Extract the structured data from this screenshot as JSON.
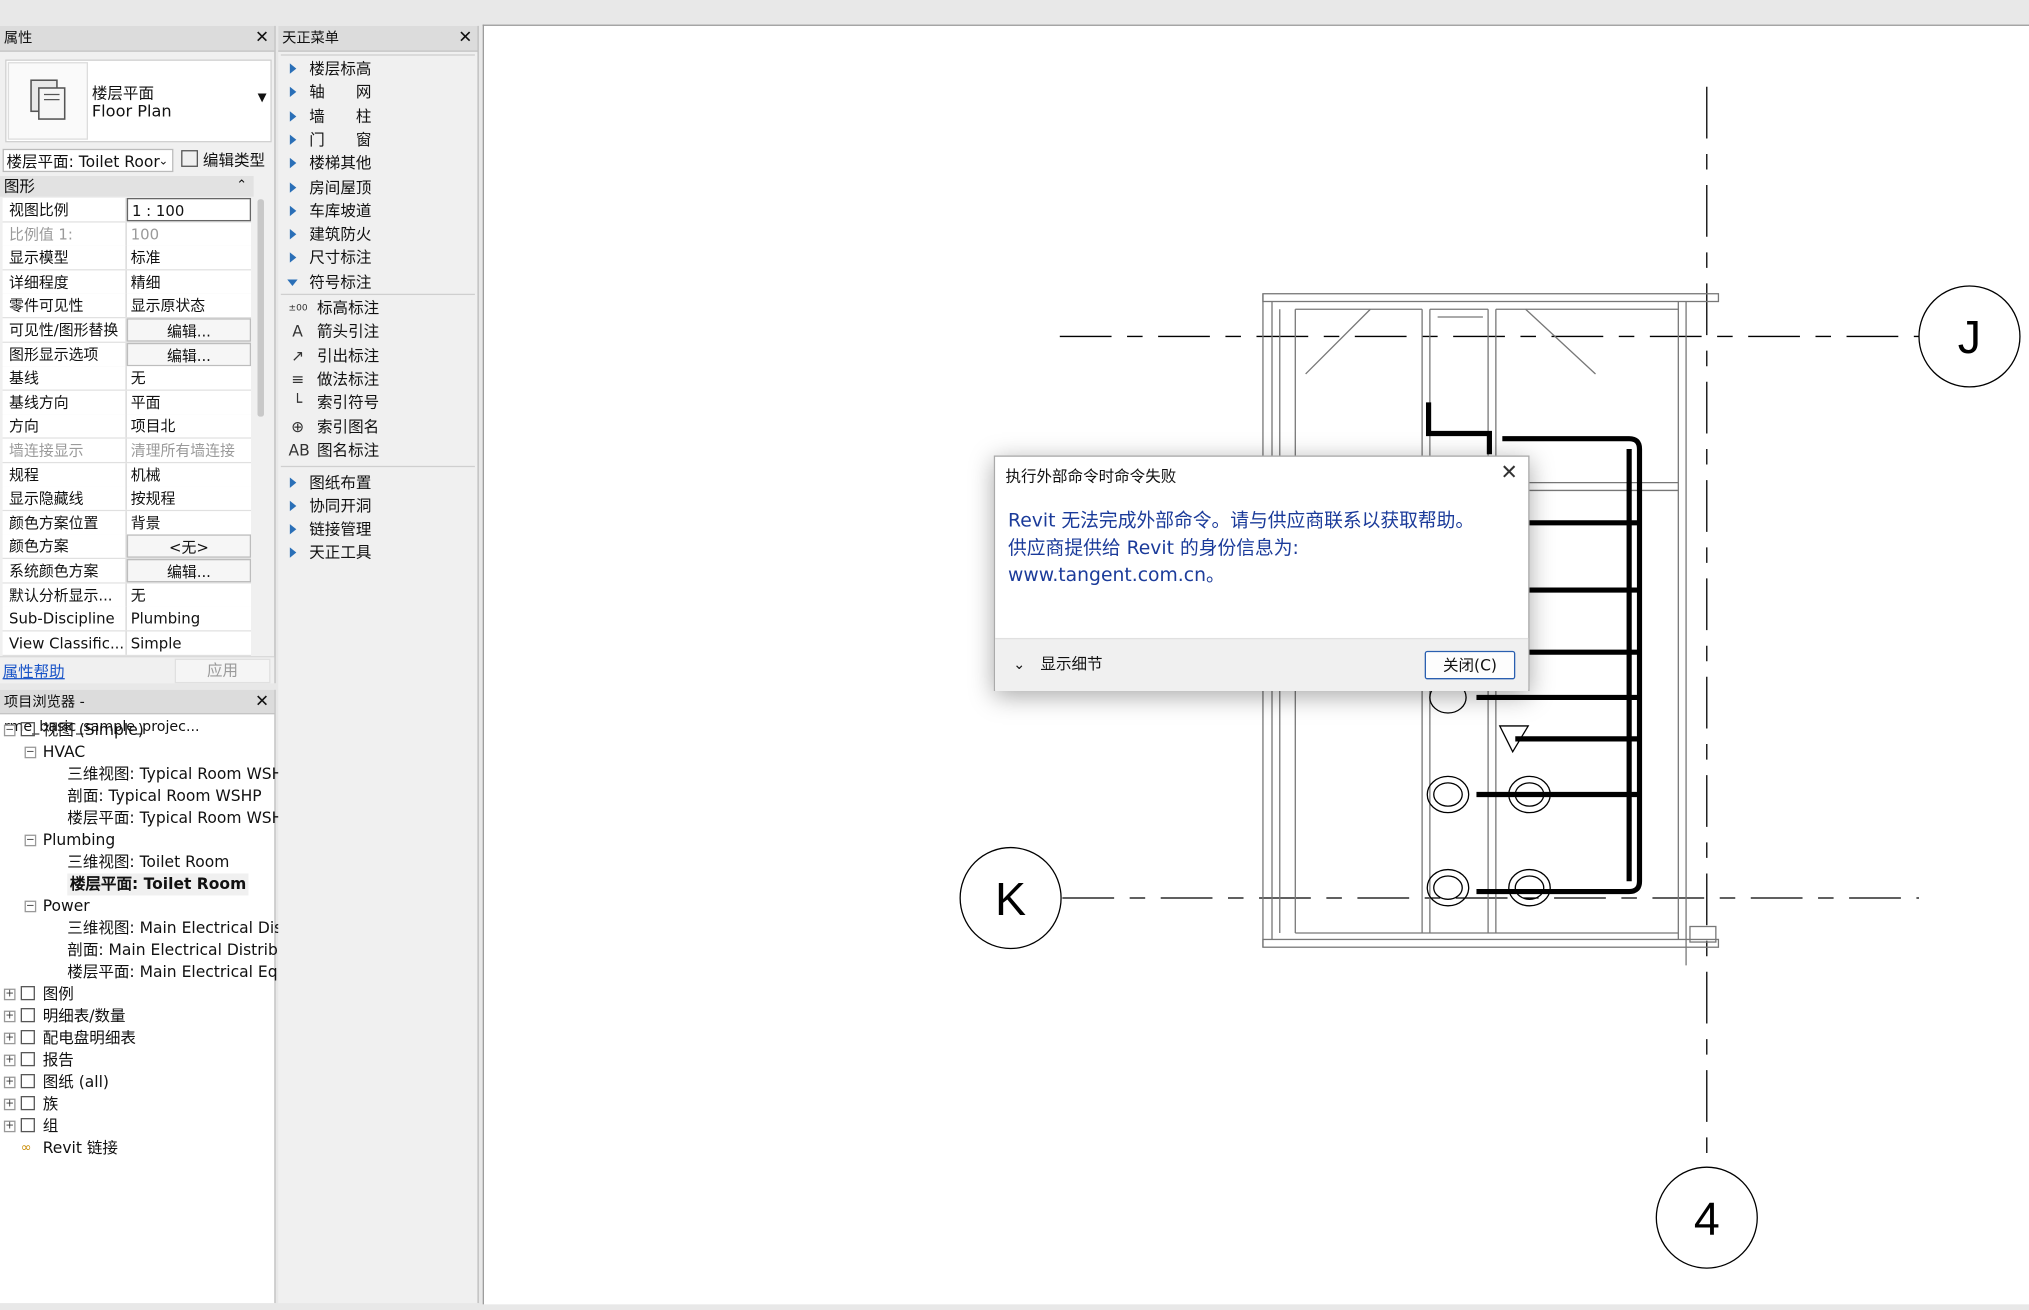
{
  "properties": {
    "title": "属性",
    "type_line1": "楼层平面",
    "type_line2": "Floor Plan",
    "selector": "楼层平面: Toilet Roor",
    "edit_type": "编辑类型",
    "section": "图形",
    "rows": [
      {
        "k": "视图比例",
        "v": "1 : 100"
      },
      {
        "k": "比例值 1:",
        "v": "100"
      },
      {
        "k": "显示模型",
        "v": "标准"
      },
      {
        "k": "详细程度",
        "v": "精细"
      },
      {
        "k": "零件可见性",
        "v": "显示原状态"
      },
      {
        "k": "可见性/图形替换",
        "v": "编辑..."
      },
      {
        "k": "图形显示选项",
        "v": "编辑..."
      },
      {
        "k": "基线",
        "v": "无"
      },
      {
        "k": "基线方向",
        "v": "平面"
      },
      {
        "k": "方向",
        "v": "项目北"
      },
      {
        "k": "墙连接显示",
        "v": "清理所有墙连接"
      },
      {
        "k": "规程",
        "v": "机械"
      },
      {
        "k": "显示隐藏线",
        "v": "按规程"
      },
      {
        "k": "颜色方案位置",
        "v": "背景"
      },
      {
        "k": "颜色方案",
        "v": "<无>"
      },
      {
        "k": "系统颜色方案",
        "v": "编辑..."
      },
      {
        "k": "默认分析显示...",
        "v": "无"
      },
      {
        "k": "Sub-Discipline",
        "v": "Plumbing"
      },
      {
        "k": "View Classific...",
        "v": "Simple"
      }
    ],
    "help": "属性帮助",
    "apply": "应用"
  },
  "browser": {
    "title": "项目浏览器 - rme_basic_sample_projec...",
    "root": "视图 (Simple)",
    "groups": [
      {
        "name": "HVAC",
        "items": [
          "三维视图: Typical Room WSH",
          "剖面: Typical Room WSHP",
          "楼层平面: Typical Room WSH"
        ]
      },
      {
        "name": "Plumbing",
        "items": [
          "三维视图: Toilet Room",
          "楼层平面: Toilet Room"
        ]
      },
      {
        "name": "Power",
        "items": [
          "三维视图: Main Electrical Dist",
          "剖面: Main Electrical Distribu",
          "楼层平面: Main Electrical Equ"
        ]
      }
    ],
    "others": [
      "图例",
      "明细表/数量",
      "配电盘明细表",
      "报告",
      "图纸 (all)",
      "族",
      "组",
      "Revit 链接"
    ]
  },
  "tz_menu": {
    "title": "天正菜单",
    "items_top": [
      "楼层标高",
      "轴　　网",
      "墙　　柱",
      "门　　窗",
      "楼梯其他",
      "房间屋顶",
      "车库坡道",
      "建筑防火",
      "尺寸标注"
    ],
    "expanded": "符号标注",
    "sub": [
      {
        "icon": "±00",
        "label": "标高标注"
      },
      {
        "icon": "A",
        "label": "箭头引注"
      },
      {
        "icon": "↗",
        "label": "引出标注"
      },
      {
        "icon": "≡",
        "label": "做法标注"
      },
      {
        "icon": "└",
        "label": "索引符号"
      },
      {
        "icon": "⊕",
        "label": "索引图名"
      },
      {
        "icon": "AB",
        "label": "图名标注"
      }
    ],
    "items_bottom": [
      "图纸布置",
      "协同开洞",
      "链接管理",
      "天正工具"
    ]
  },
  "canvas": {
    "grid_labels": [
      "J",
      "K",
      "4"
    ]
  },
  "dialog": {
    "title": "执行外部命令时命令失败",
    "message_l1": "Revit 无法完成外部命令。请与供应商联系以获取帮助。",
    "message_l2": "供应商提供给 Revit 的身份信息为:",
    "message_l3": "www.tangent.com.cn。",
    "details": "显示细节",
    "close_btn": "关闭(C)"
  }
}
